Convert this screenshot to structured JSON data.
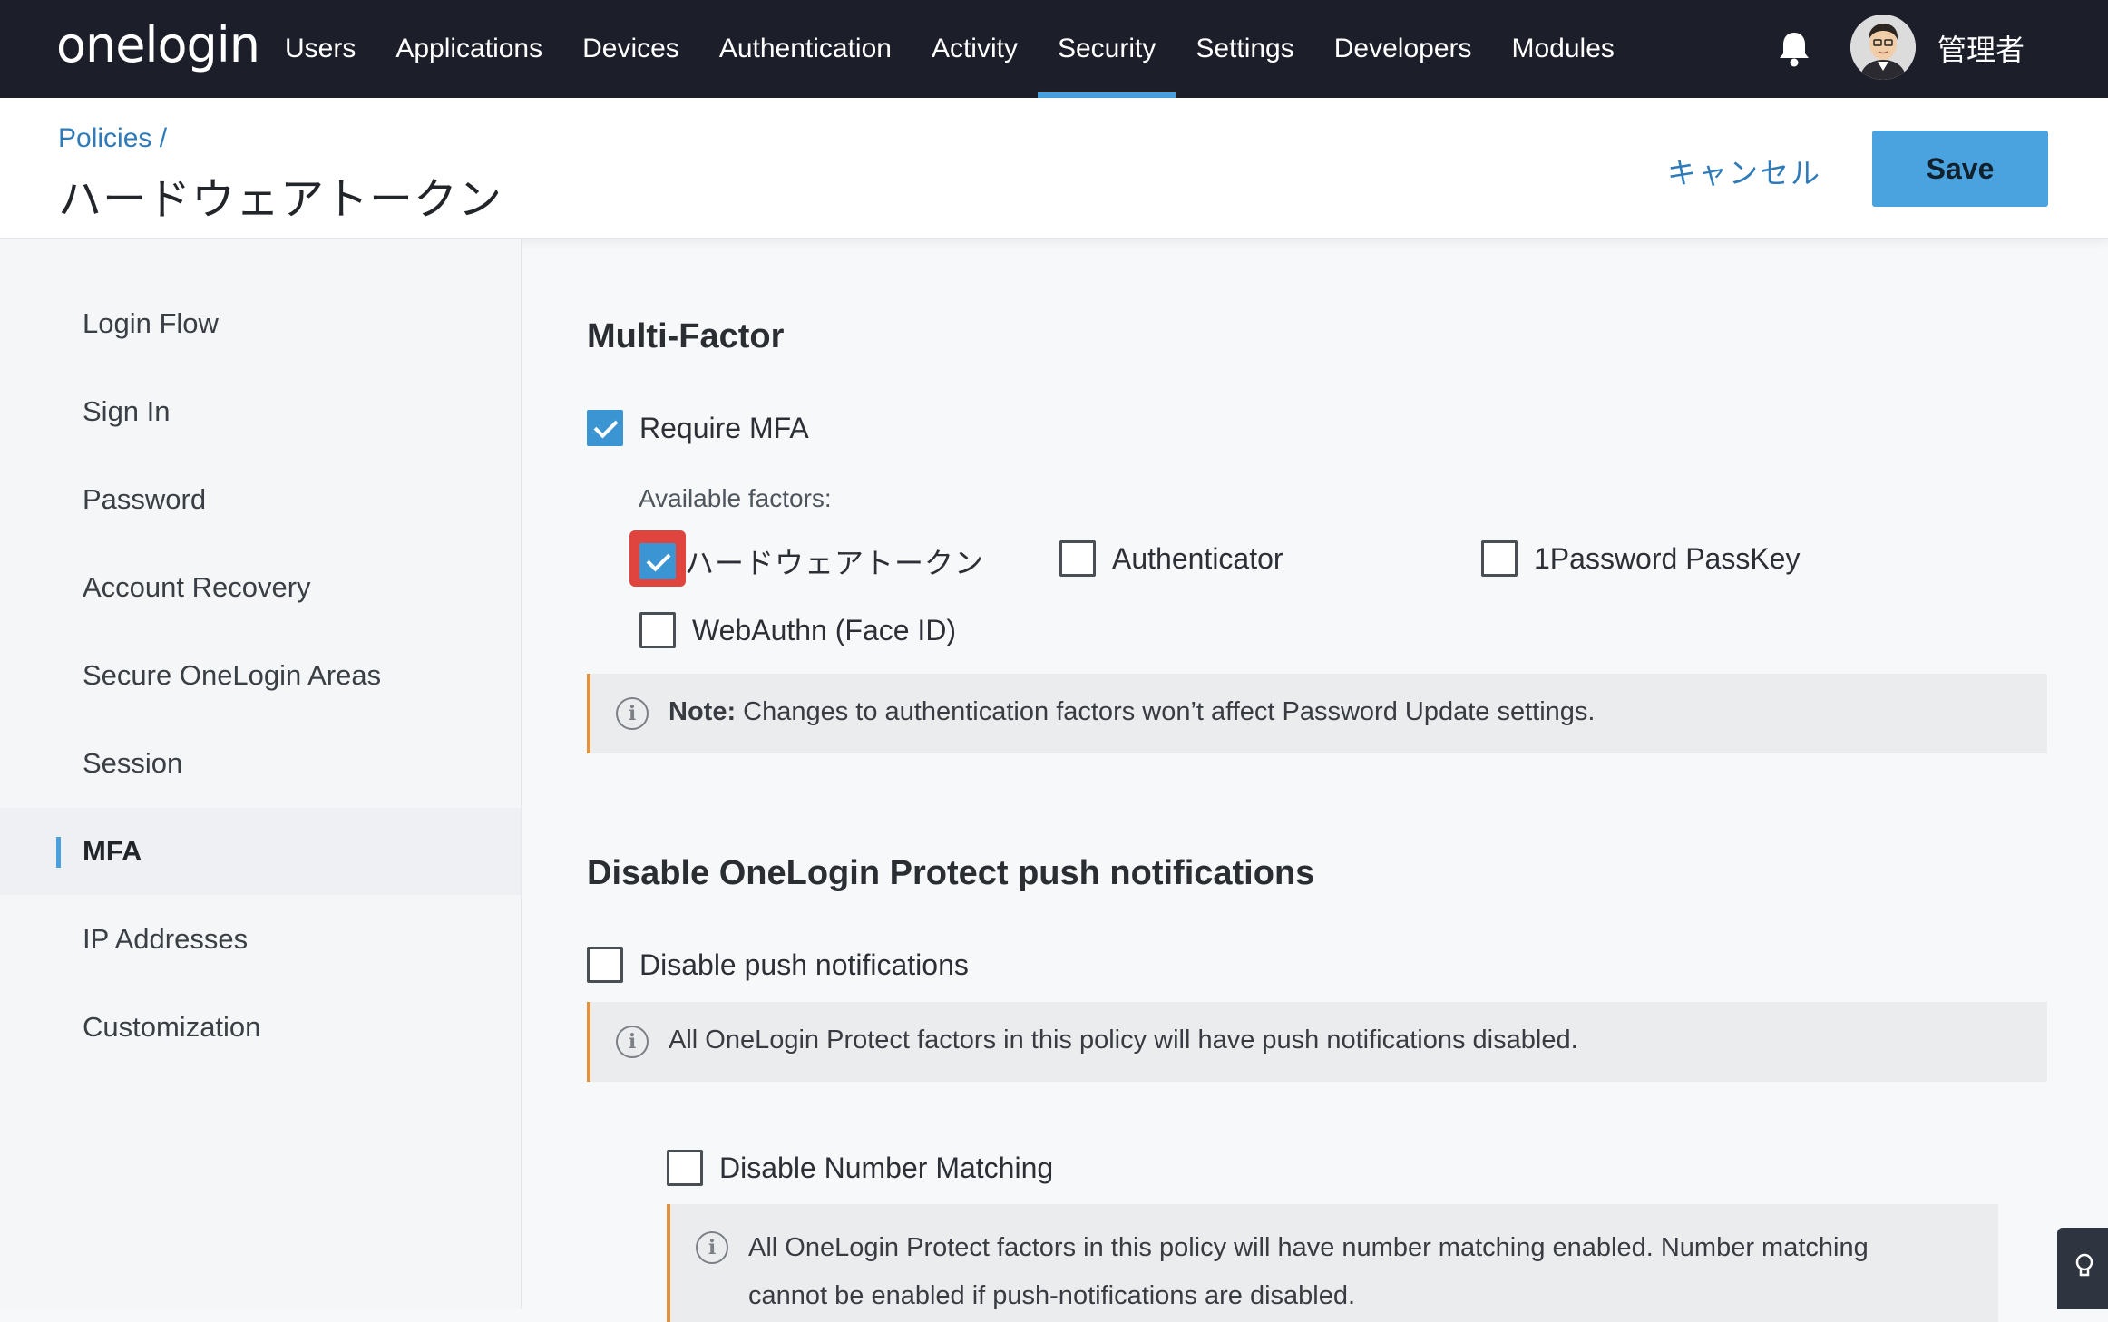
{
  "app": {
    "logo": "onelogin"
  },
  "topnav": {
    "items": [
      {
        "label": "Users"
      },
      {
        "label": "Applications"
      },
      {
        "label": "Devices"
      },
      {
        "label": "Authentication"
      },
      {
        "label": "Activity"
      },
      {
        "label": "Security",
        "active": true
      },
      {
        "label": "Settings"
      },
      {
        "label": "Developers"
      },
      {
        "label": "Modules"
      }
    ],
    "username": "管理者",
    "icons": {
      "notifications": "bell-icon",
      "avatar": "user-avatar"
    }
  },
  "header": {
    "breadcrumb": "Policies /",
    "title": "ハードウェアトークン",
    "cancel_label": "キャンセル",
    "save_label": "Save"
  },
  "sidebar": {
    "items": [
      {
        "label": "Login Flow"
      },
      {
        "label": "Sign In"
      },
      {
        "label": "Password"
      },
      {
        "label": "Account Recovery"
      },
      {
        "label": "Secure OneLogin Areas"
      },
      {
        "label": "Session"
      },
      {
        "label": "MFA",
        "active": true
      },
      {
        "label": "IP Addresses"
      },
      {
        "label": "Customization"
      }
    ]
  },
  "mfa": {
    "title": "Multi-Factor",
    "require_mfa_label": "Require MFA",
    "require_mfa_checked": true,
    "available_factors_label": "Available factors:",
    "factors": [
      {
        "label": "ハードウェアトークン",
        "checked": true
      },
      {
        "label": "Authenticator",
        "checked": false
      },
      {
        "label": "1Password PassKey",
        "checked": false
      },
      {
        "label": "WebAuthn (Face ID)",
        "checked": false
      }
    ],
    "note_bold": "Note:",
    "note_text": " Changes to authentication factors won’t affect Password Update settings."
  },
  "push": {
    "title": "Disable OneLogin Protect push notifications",
    "disable_push_label": "Disable push notifications",
    "disable_push_checked": false,
    "push_note": "All OneLogin Protect factors in this policy will have push notifications disabled.",
    "disable_number_matching_label": "Disable Number Matching",
    "disable_number_matching_checked": false,
    "number_matching_note": "All OneLogin Protect factors in this policy will have number matching enabled. Number matching cannot be enabled if push-notifications are disabled."
  },
  "colors": {
    "nav_bg": "#1c1f2a",
    "accent": "#4a9fdd",
    "save_button": "#4aa3df",
    "note_border": "#e6923a",
    "highlight": "#e0443f"
  }
}
